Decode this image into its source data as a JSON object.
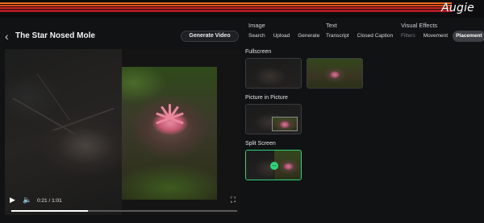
{
  "app": {
    "logo": "Augie"
  },
  "header": {
    "back_icon": "chevron-left-icon",
    "title": "The Star Nosed Mole"
  },
  "actions": {
    "generate_video_label": "Generate Video"
  },
  "groups": {
    "image": {
      "label": "Image",
      "tabs": [
        "Search",
        "Upload",
        "Generate"
      ]
    },
    "text": {
      "label": "Text",
      "tabs": [
        "Transcript",
        "Closed Caption"
      ]
    },
    "visual_effects": {
      "label": "Visual Effects",
      "tabs": [
        "Filters",
        "Movement",
        "Placement"
      ],
      "active": "Placement"
    }
  },
  "player": {
    "time": "0:21 / 1:01",
    "progress": 0.34,
    "icons": {
      "play": "play-icon",
      "volume": "volume-icon",
      "fullscreen": "fullscreen-icon"
    }
  },
  "placement": {
    "sections": [
      {
        "label": "Fullscreen"
      },
      {
        "label": "Picture in Picture"
      },
      {
        "label": "Split Screen",
        "selected": true
      }
    ]
  },
  "colors": {
    "accent": "#2fd37a",
    "active_tab": "#3d3e43",
    "stripe_orange": "#f26a1b",
    "stripe_red": "#d4271e"
  }
}
